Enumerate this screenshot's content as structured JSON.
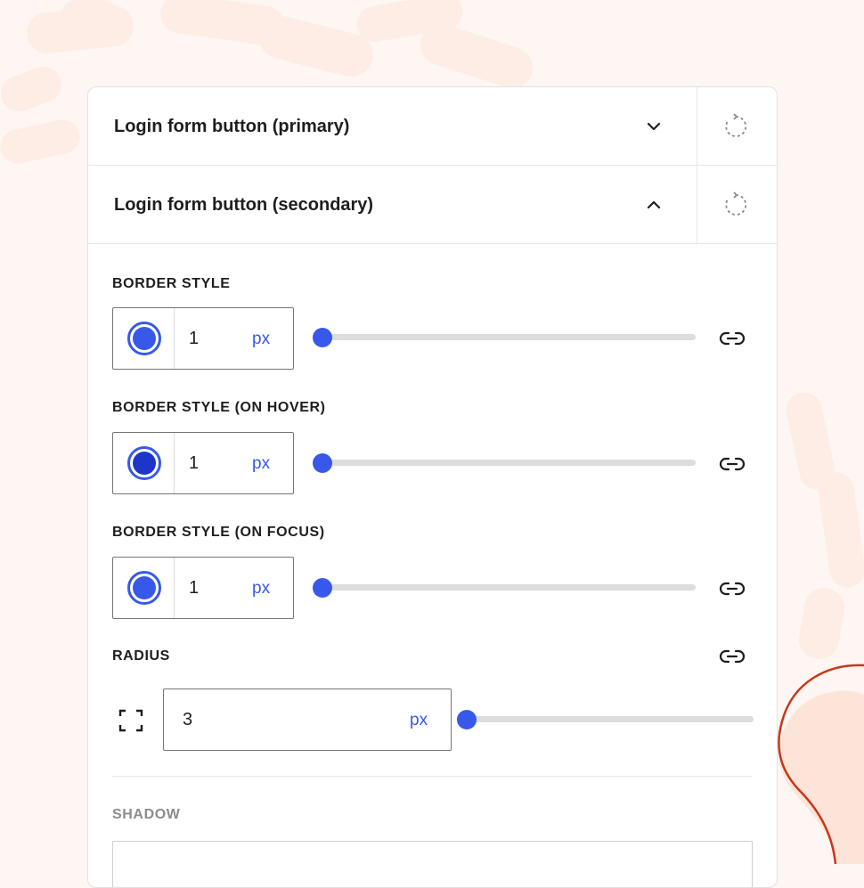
{
  "theme": {
    "accent": "#3858e9",
    "accent_dark": "#1d35c9",
    "background": "#fdf6f2",
    "panel": "#ffffff",
    "deco_stroke": "#c8361a",
    "deco_fill": "#fde4d8"
  },
  "accordion": [
    {
      "title": "Login form button (primary)",
      "expanded": false,
      "chevron_icon": "chevron-down-icon",
      "reset_icon": "reset-icon"
    },
    {
      "title": "Login form button (secondary)",
      "expanded": true,
      "chevron_icon": "chevron-up-icon",
      "reset_icon": "reset-icon"
    }
  ],
  "border_style": {
    "label": "BORDER STYLE",
    "color": "#3858e9",
    "width": "1",
    "unit": "px",
    "slider_fraction": 0.0,
    "link_icon": "link-icon"
  },
  "border_style_hover": {
    "label": "BORDER STYLE (ON HOVER)",
    "color": "#1d35c9",
    "width": "1",
    "unit": "px",
    "slider_fraction": 0.0,
    "link_icon": "link-icon"
  },
  "border_style_focus": {
    "label": "BORDER STYLE (ON FOCUS)",
    "color": "#3858e9",
    "width": "1",
    "unit": "px",
    "slider_fraction": 0.0,
    "link_icon": "link-icon"
  },
  "radius": {
    "label": "RADIUS",
    "value": "3",
    "unit": "px",
    "slider_fraction": 0.0,
    "corner_icon": "corners-icon",
    "link_icon": "link-icon"
  },
  "shadow": {
    "label": "SHADOW"
  }
}
